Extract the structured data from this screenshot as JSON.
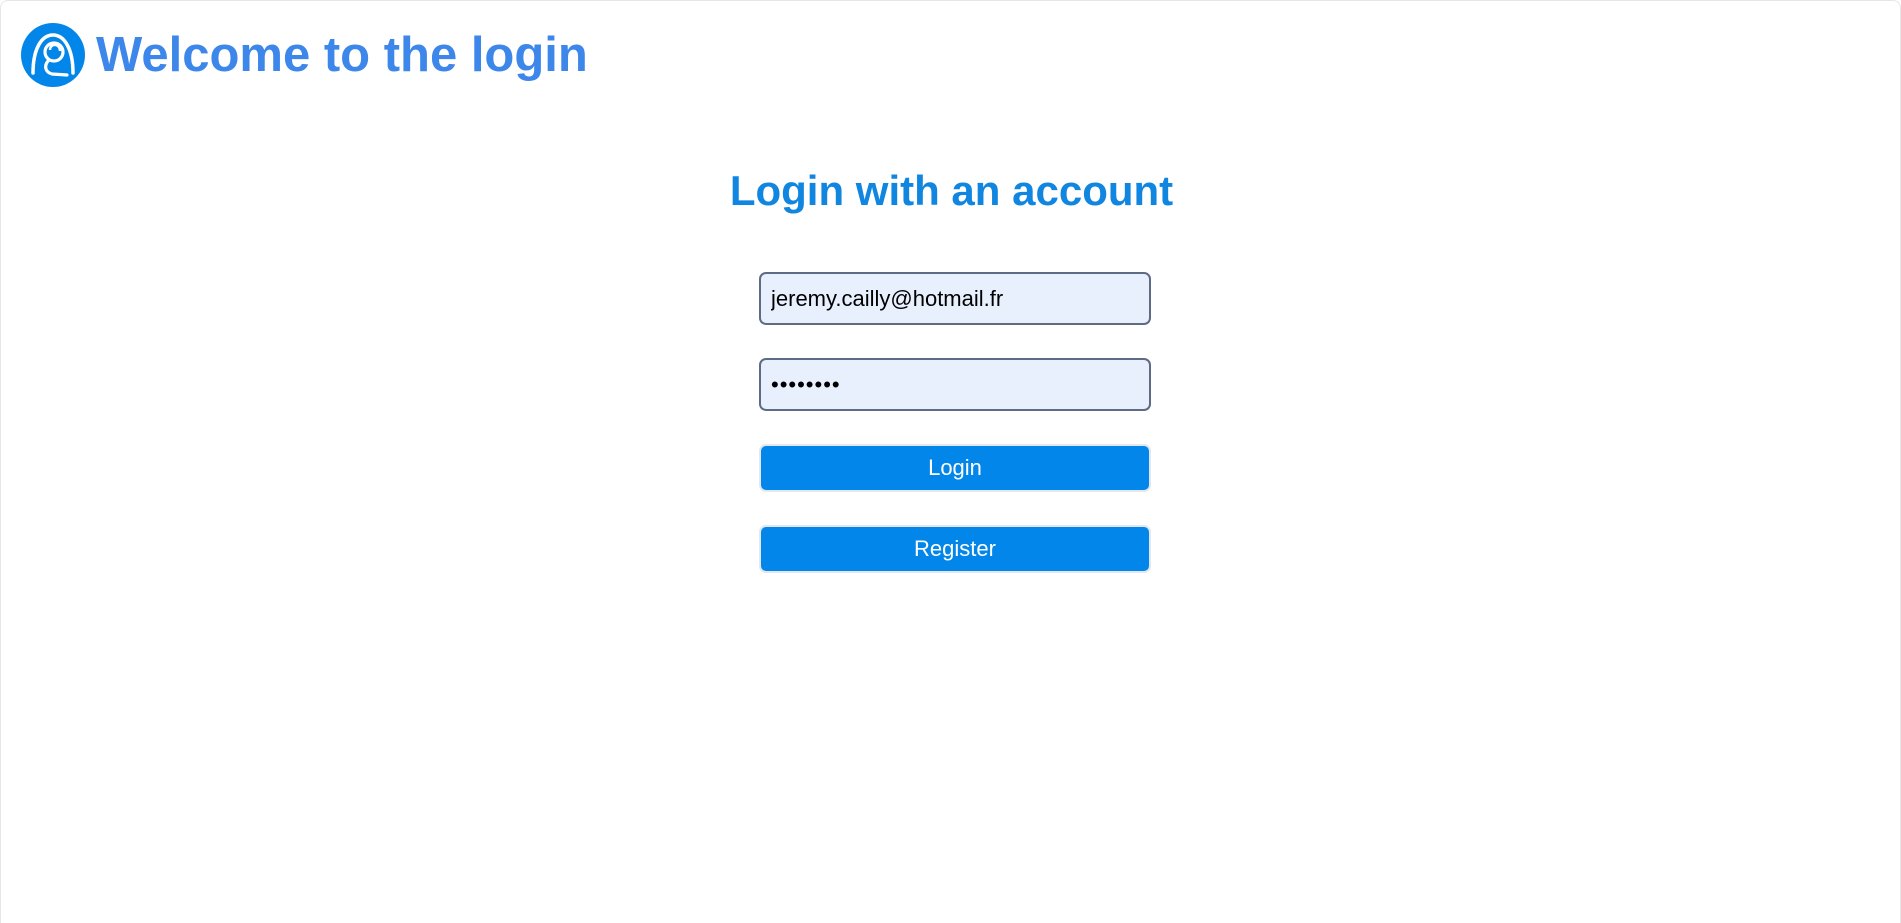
{
  "header": {
    "logo_icon": "user-headset-icon",
    "title": "Welcome to the login"
  },
  "login_form": {
    "heading": "Login with an account",
    "email": {
      "value": "jeremy.cailly@hotmail.fr",
      "type": "email"
    },
    "password": {
      "value": "password",
      "type": "password"
    },
    "login_label": "Login",
    "register_label": "Register"
  },
  "colors": {
    "title": "#3d86ea",
    "heading": "#1186e0",
    "button": "#0386e9",
    "input_background": "#e8f0fe",
    "input_border": "#5d6b85"
  }
}
